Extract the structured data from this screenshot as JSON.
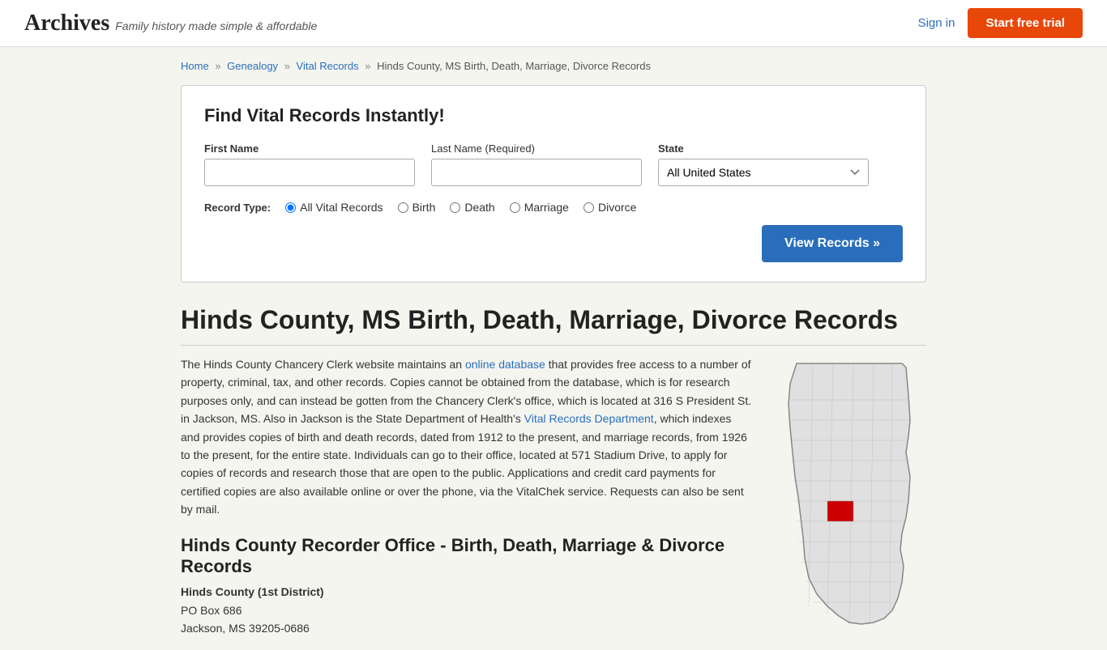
{
  "header": {
    "logo": "Archives",
    "tagline": "Family history made simple & affordable",
    "signin_label": "Sign in",
    "trial_label": "Start free trial"
  },
  "breadcrumb": {
    "items": [
      {
        "label": "Home",
        "href": "#"
      },
      {
        "label": "Genealogy",
        "href": "#"
      },
      {
        "label": "Vital Records",
        "href": "#"
      },
      {
        "label": "Hinds County, MS Birth, Death, Marriage, Divorce Records"
      }
    ]
  },
  "search": {
    "title": "Find Vital Records Instantly!",
    "first_name_label": "First Name",
    "last_name_label": "Last Name",
    "last_name_required": "(Required)",
    "state_label": "State",
    "state_default": "All United States",
    "record_type_label": "Record Type:",
    "record_types": [
      {
        "label": "All Vital Records",
        "value": "all",
        "checked": true
      },
      {
        "label": "Birth",
        "value": "birth",
        "checked": false
      },
      {
        "label": "Death",
        "value": "death",
        "checked": false
      },
      {
        "label": "Marriage",
        "value": "marriage",
        "checked": false
      },
      {
        "label": "Divorce",
        "value": "divorce",
        "checked": false
      }
    ],
    "view_records_label": "View Records »"
  },
  "page": {
    "title": "Hinds County, MS Birth, Death, Marriage, Divorce Records",
    "body_text": "The Hinds County Chancery Clerk website maintains an online database that provides free access to a number of property, criminal, tax, and other records. Copies cannot be obtained from the database, which is for research purposes only, and can instead be gotten from the Chancery Clerk's office, which is located at 316 S President St. in Jackson, MS. Also in Jackson is the State Department of Health's Vital Records Department, which indexes and provides copies of birth and death records, dated from 1912 to the present, and marriage records, from 1926 to the present, for the entire state. Individuals can go to their office, located at 571 Stadium Drive, to apply for copies of records and research those that are open to the public. Applications and credit card payments for certified copies are also available online or over the phone, via the VitalChek service. Requests can also be sent by mail.",
    "section2_title": "Hinds County Recorder Office - Birth, Death, Marriage & Divorce Records",
    "office_name": "Hinds County (1st District)",
    "office_address1": "PO Box 686",
    "office_address2": "Jackson, MS 39205-0686"
  }
}
